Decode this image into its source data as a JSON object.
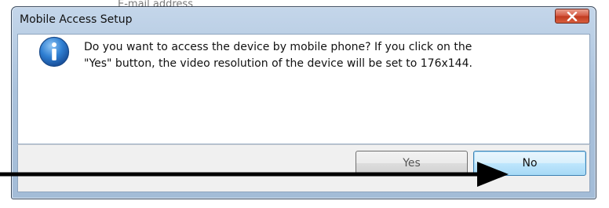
{
  "background": {
    "partial_text": "E-mail address"
  },
  "dialog": {
    "title": "Mobile Access Setup",
    "close_glyph": "X",
    "icon": "info-icon",
    "message_line1": "Do you want to access the device by mobile phone? If you click on the",
    "message_line2": "\"Yes\" button, the video resolution of the device will be set to 176x144.",
    "buttons": {
      "yes": "Yes",
      "no": "No"
    }
  },
  "annotation": {
    "icon": "arrow-right-icon",
    "color": "#000000"
  },
  "colors": {
    "title_bar": "#aac2dc",
    "close_button": "#c0391f",
    "default_button_border": "#3c7fb1"
  }
}
